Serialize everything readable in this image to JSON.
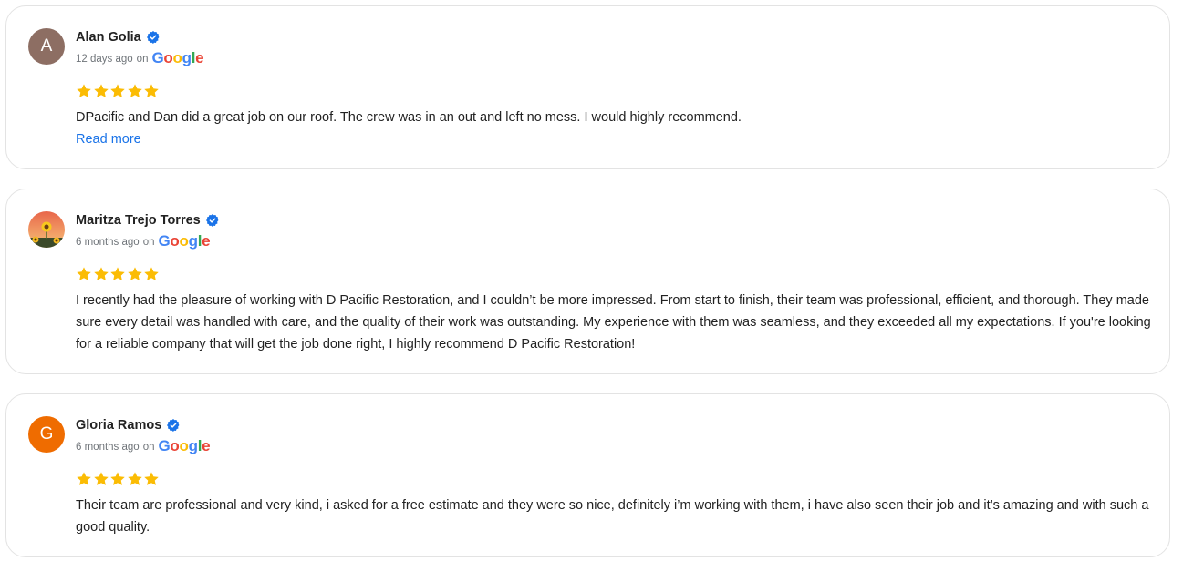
{
  "reviews": [
    {
      "avatar_letter": "A",
      "name": "Alan Golia",
      "time": "12 days ago",
      "on": "on",
      "source": "Google",
      "rating": 5,
      "text": "DPacific and Dan did a great job on our roof. The crew was in an out and left no mess. I would highly recommend.",
      "read_more": "Read more"
    },
    {
      "avatar_letter": "",
      "avatar_icon": "sunflower-photo",
      "name": "Maritza Trejo Torres",
      "time": "6 months ago",
      "on": "on",
      "source": "Google",
      "rating": 5,
      "text": "I recently had the pleasure of working with D Pacific Restoration, and I couldn’t be more impressed. From start to finish, their team was professional, efficient, and thorough. They made sure every detail was handled with care, and the quality of their work was outstanding. My experience with them was seamless, and they exceeded all my expectations. If you're looking for a reliable company that will get the job done right, I highly recommend D Pacific Restoration!"
    },
    {
      "avatar_letter": "G",
      "name": "Gloria Ramos",
      "time": "6 months ago",
      "on": "on",
      "source": "Google",
      "rating": 5,
      "text": "Their team are professional and very kind, i asked for a free estimate and they were so nice, definitely i’m working with them, i have also seen their job and it’s amazing and with such a good quality."
    }
  ],
  "colors": {
    "verified": "#1a73e8",
    "star": "#fbbc04",
    "link": "#1a73e8",
    "google_blue": "#4285f4",
    "google_red": "#ea4335",
    "google_yellow": "#fbbc05",
    "google_green": "#34a853"
  }
}
